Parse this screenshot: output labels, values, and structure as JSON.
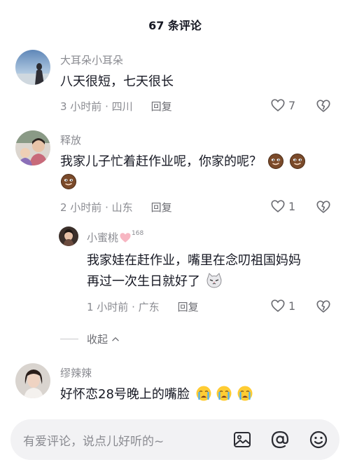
{
  "header": {
    "title": "67 条评论"
  },
  "comments": [
    {
      "username": "大耳朵小耳朵",
      "text": "八天很短，七天很长",
      "time": "3 小时前",
      "location": "四川",
      "reply_label": "回复",
      "likes": "7"
    },
    {
      "username": "释放",
      "text": "我家儿子忙着赶作业呢，你家的呢？",
      "time": "2 小时前",
      "location": "山东",
      "reply_label": "回复",
      "likes": "1",
      "emojis": [
        "smug-face",
        "smug-face",
        "smug-face"
      ]
    }
  ],
  "reply": {
    "username": "小蜜桃",
    "badge": "168",
    "line1": "我家娃在赶作业，嘴里在念叨祖国妈妈",
    "line2": "再过一次生日就好了",
    "time": "1 小时前",
    "location": "广东",
    "reply_label": "回复",
    "likes": "1",
    "emoji": "cat-face"
  },
  "collapse_label": "收起",
  "comment3": {
    "username": "缪辣辣",
    "text": "好怀恋28号晚上的嘴脸",
    "emojis": [
      "crying-face",
      "crying-face",
      "crying-face"
    ]
  },
  "input": {
    "placeholder": "有爱评论，说点儿好听的~",
    "icons": [
      "image-icon",
      "at-icon",
      "emoji-icon"
    ]
  }
}
